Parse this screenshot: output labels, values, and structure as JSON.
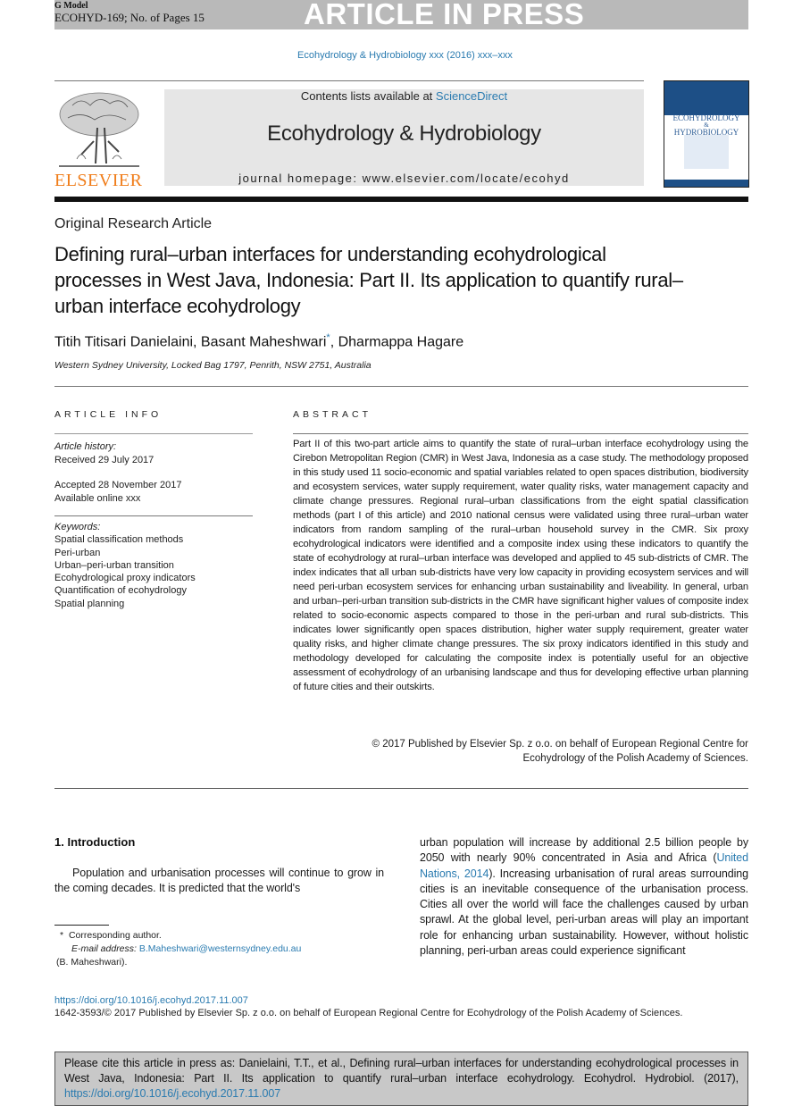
{
  "banner": {
    "model": "G Model",
    "id_pages": "ECOHYD-169; No. of Pages 15",
    "status": "ARTICLE IN PRESS"
  },
  "journal_ref": "Ecohydrology & Hydrobiology xxx (2016) xxx–xxx",
  "masthead": {
    "publisher": "ELSEVIER",
    "contents_prefix": "Contents lists available at ",
    "contents_link": "ScienceDirect",
    "journal_title": "Ecohydrology & Hydrobiology",
    "homepage": "journal homepage: www.elsevier.com/locate/ecohyd",
    "cover_title_1": "ECOHYDROLOGY",
    "cover_title_amp": "&",
    "cover_title_2": "HYDROBIOLOGY"
  },
  "article": {
    "type": "Original Research Article",
    "title": "Defining rural–urban interfaces for understanding ecohydrological processes in West Java, Indonesia: Part II. Its application to quantify rural–urban interface ecohydrology",
    "authors": [
      "Titih Titisari Danielaini",
      "Basant Maheshwari",
      "Dharmappa Hagare"
    ],
    "corresponding_marker": "*",
    "affiliation": "Western Sydney University, Locked Bag 1797, Penrith, NSW 2751, Australia"
  },
  "article_info": {
    "heading": "ARTICLE INFO",
    "history_label": "Article history:",
    "received": "Received 29 July 2017",
    "accepted": "Accepted 28 November 2017",
    "available": "Available online xxx",
    "keywords_label": "Keywords:",
    "keywords": [
      "Spatial classification methods",
      "Peri-urban",
      "Urban–peri-urban transition",
      "Ecohydrological proxy indicators",
      "Quantification of ecohydrology",
      "Spatial planning"
    ]
  },
  "abstract": {
    "heading": "ABSTRACT",
    "text": "Part II of this two-part article aims to quantify the state of rural–urban interface ecohydrology using the Cirebon Metropolitan Region (CMR) in West Java, Indonesia as a case study. The methodology proposed in this study used 11 socio-economic and spatial variables related to open spaces distribution, biodiversity and ecosystem services, water supply requirement, water quality risks, water management capacity and climate change pressures. Regional rural–urban classifications from the eight spatial classification methods (part I of this article) and 2010 national census were validated using three rural–urban water indicators from random sampling of the rural–urban household survey in the CMR. Six proxy ecohydrological indicators were identified and a composite index using these indicators to quantify the state of ecohydrology at rural–urban interface was developed and applied to 45 sub-districts of CMR. The index indicates that all urban sub-districts have very low capacity in providing ecosystem services and will need peri-urban ecosystem services for enhancing urban sustainability and liveability. In general, urban and urban–peri-urban transition sub-districts in the CMR have significant higher values of composite index related to socio-economic aspects compared to those in the peri-urban and rural sub-districts. This indicates lower significantly open spaces distribution, higher water supply requirement, greater water quality risks, and higher climate change pressures. The six proxy indicators identified in this study and methodology developed for calculating the composite index is potentially useful for an objective assessment of ecohydrology of an urbanising landscape and thus for developing effective urban planning of future cities and their outskirts.",
    "copyright_line1": "© 2017 Published by Elsevier Sp. z o.o. on behalf of European Regional Centre for",
    "copyright_line2": "Ecohydrology of the Polish Academy of Sciences."
  },
  "introduction": {
    "heading": "1.  Introduction",
    "left_text": "Population and urbanisation processes will continue to grow in the coming decades. It is predicted that the world's",
    "right_text_pre": "urban population will increase by additional 2.5 billion people by 2050 with nearly 90% concentrated in Asia and Africa (",
    "right_citation": "United Nations, 2014",
    "right_text_post": "). Increasing urbanisation of rural areas surrounding cities is an inevitable consequence of the urbanisation process. Cities all over the world will face the challenges caused by urban sprawl. At the global level, peri-urban areas will play an important role for enhancing urban sustainability. However, without holistic planning, peri-urban areas could experience significant"
  },
  "footnote": {
    "marker": "*",
    "corresponding": "Corresponding author.",
    "email_label": "E-mail address:",
    "email": "B.Maheshwari@westernsydney.edu.au",
    "name": "(B. Maheshwari)."
  },
  "footer": {
    "doi": "https://doi.org/10.1016/j.ecohyd.2017.11.007",
    "issn_line": "1642-3593/© 2017 Published by Elsevier Sp. z o.o. on behalf of European Regional Centre for Ecohydrology of the Polish Academy of Sciences."
  },
  "citation_box": {
    "text": "Please cite this article in press as: Danielaini, T.T., et al., Defining rural–urban interfaces for understanding ecohydrological processes in West Java, Indonesia: Part II. Its application to quantify rural–urban interface ecohydrology. Ecohydrol. Hydrobiol. (2017), ",
    "link": "https://doi.org/10.1016/j.ecohyd.2017.11.007"
  },
  "colors": {
    "link": "#2a7bb0",
    "elsevier_orange": "#f07d1a",
    "banner_gray": "#b9b9b9",
    "masthead_gray": "#e6e6e6",
    "cite_box_gray": "#c8c8c8"
  }
}
